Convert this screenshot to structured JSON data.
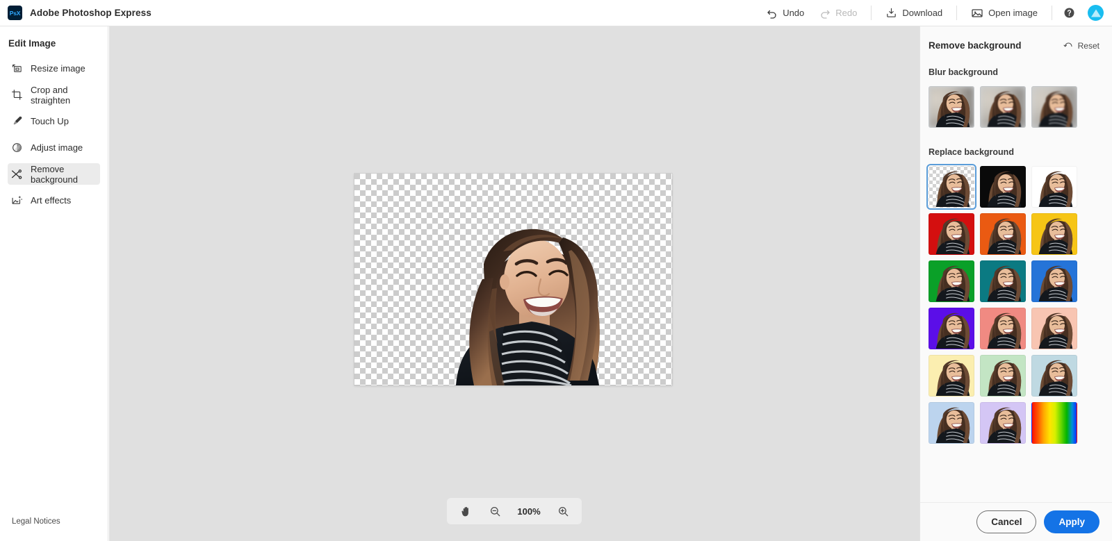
{
  "app": {
    "title": "Adobe Photoshop Express",
    "logo_text": "PsX"
  },
  "topbar": {
    "undo_label": "Undo",
    "redo_label": "Redo",
    "download_label": "Download",
    "open_image_label": "Open image",
    "undo_icon": "undo-arrow-icon",
    "redo_icon": "redo-arrow-icon",
    "download_icon": "download-tray-icon",
    "open_image_icon": "picture-icon",
    "help_icon": "help-circle-icon",
    "avatar_icon": "user-avatar"
  },
  "sidebar": {
    "title": "Edit Image",
    "legal_label": "Legal Notices",
    "items": [
      {
        "label": "Resize image",
        "icon": "resize-icon",
        "active": false
      },
      {
        "label": "Crop and straighten",
        "icon": "crop-icon",
        "active": false
      },
      {
        "label": "Touch Up",
        "icon": "brush-icon",
        "active": false
      },
      {
        "label": "Adjust image",
        "icon": "contrast-icon",
        "active": false
      },
      {
        "label": "Remove background",
        "icon": "scissors-icon",
        "active": true
      },
      {
        "label": "Art effects",
        "icon": "art-effects-icon",
        "active": false
      }
    ]
  },
  "canvas": {
    "background_type": "transparent-checkerboard",
    "zoom_level": "100%",
    "hand_tool_icon": "hand-icon",
    "zoom_out_icon": "zoom-out-icon",
    "zoom_in_icon": "zoom-in-icon"
  },
  "right_panel": {
    "title": "Remove background",
    "reset_label": "Reset",
    "reset_icon": "reset-arrow-icon",
    "blur_section_title": "Blur background",
    "blur_options": [
      {
        "name": "blur-low",
        "strength": 1,
        "selected": false
      },
      {
        "name": "blur-medium",
        "strength": 2,
        "selected": false
      },
      {
        "name": "blur-high",
        "strength": 3,
        "selected": false
      }
    ],
    "replace_section_title": "Replace background",
    "replace_options": [
      {
        "name": "transparent",
        "color": "transparent",
        "selected": true
      },
      {
        "name": "black",
        "color": "#0a0a0a",
        "selected": false
      },
      {
        "name": "white",
        "color": "#ffffff",
        "selected": false
      },
      {
        "name": "red",
        "color": "#d40f0f",
        "selected": false
      },
      {
        "name": "orange",
        "color": "#ea5a12",
        "selected": false
      },
      {
        "name": "yellow",
        "color": "#f6c516",
        "selected": false
      },
      {
        "name": "green",
        "color": "#0aa028",
        "selected": false
      },
      {
        "name": "teal",
        "color": "#0b7a82",
        "selected": false
      },
      {
        "name": "blue",
        "color": "#2574d8",
        "selected": false
      },
      {
        "name": "violet",
        "color": "#5b0ee8",
        "selected": false
      },
      {
        "name": "salmon",
        "color": "#f08a82",
        "selected": false
      },
      {
        "name": "peach",
        "color": "#f8c5b2",
        "selected": false
      },
      {
        "name": "pale-yellow",
        "color": "#fbeeb0",
        "selected": false
      },
      {
        "name": "pale-green",
        "color": "#c3e5c4",
        "selected": false
      },
      {
        "name": "pale-blue",
        "color": "#bfd9e2",
        "selected": false
      },
      {
        "name": "light-blue",
        "color": "#bcd4ee",
        "selected": false
      },
      {
        "name": "lavender",
        "color": "#d4c6f5",
        "selected": false
      },
      {
        "name": "rainbow-gradient",
        "color": "gradient",
        "selected": false
      }
    ],
    "cancel_label": "Cancel",
    "apply_label": "Apply",
    "accent_color": "#1473e6",
    "selection_color": "#5b9dd9"
  }
}
